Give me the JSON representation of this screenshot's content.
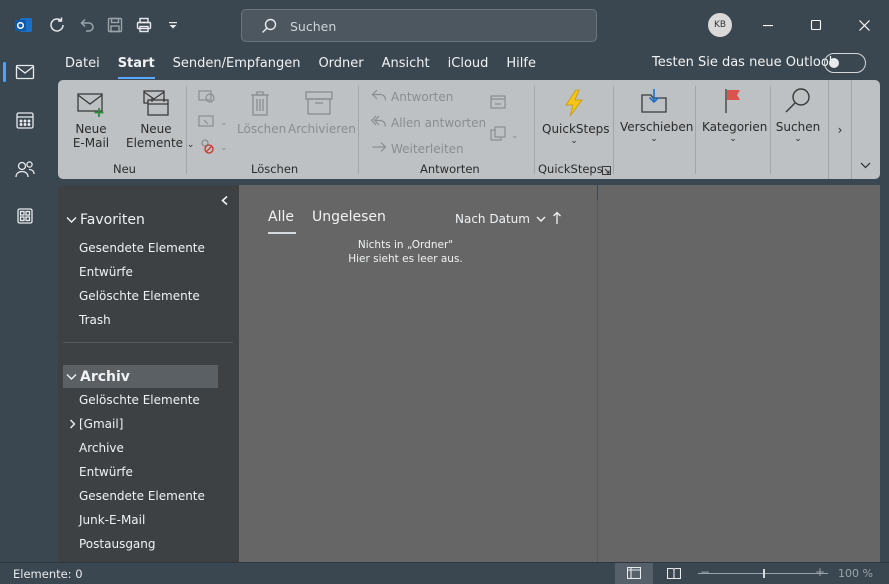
{
  "titlebar": {
    "search_placeholder": "Suchen",
    "avatar_initials": "KB"
  },
  "menu": {
    "tabs": [
      "Datei",
      "Start",
      "Senden/Empfangen",
      "Ordner",
      "Ansicht",
      "iCloud",
      "Hilfe"
    ],
    "active_tab": "Start",
    "new_outlook_label": "Testen Sie das neue Outlook"
  },
  "ribbon": {
    "new_email_line1": "Neue",
    "new_email_line2": "E-Mail",
    "new_items_line1": "Neue",
    "new_items_line2": "Elemente",
    "group_new": "Neu",
    "delete_label": "Löschen",
    "archive_label": "Archivieren",
    "group_delete": "Löschen",
    "reply_label": "Antworten",
    "reply_all_label": "Allen antworten",
    "forward_label": "Weiterleiten",
    "group_respond": "Antworten",
    "quicksteps_label": "QuickSteps",
    "group_quicksteps": "QuickSteps",
    "move_label": "Verschieben",
    "categories_label": "Kategorien",
    "search_label": "Suchen"
  },
  "folders": {
    "favorites_title": "Favoriten",
    "favorites": [
      "Gesendete Elemente",
      "Entwürfe",
      "Gelöschte Elemente",
      "Trash"
    ],
    "account_title": "Archiv",
    "account_items": [
      "Gelöschte Elemente",
      "[Gmail]",
      "Archive",
      "Entwürfe",
      "Gesendete Elemente",
      "Junk-E-Mail",
      "Postausgang"
    ]
  },
  "messagelist": {
    "tab_all": "Alle",
    "tab_unread": "Ungelesen",
    "sort_label": "Nach Datum",
    "empty_line1": "Nichts in „Ordner\"",
    "empty_line2": "Hier sieht es leer aus."
  },
  "statusbar": {
    "items_count": "Elemente: 0",
    "zoom_level": "100 %"
  },
  "colors": {
    "window_bg": "#3b4750",
    "ribbon_bg": "#bec1c3",
    "folder_pane_bg": "#3d4144",
    "list_bg": "#666666",
    "accent": "#5aa8ff",
    "quicksteps_icon": "#f5c518",
    "categories_icon": "#d9534f"
  }
}
